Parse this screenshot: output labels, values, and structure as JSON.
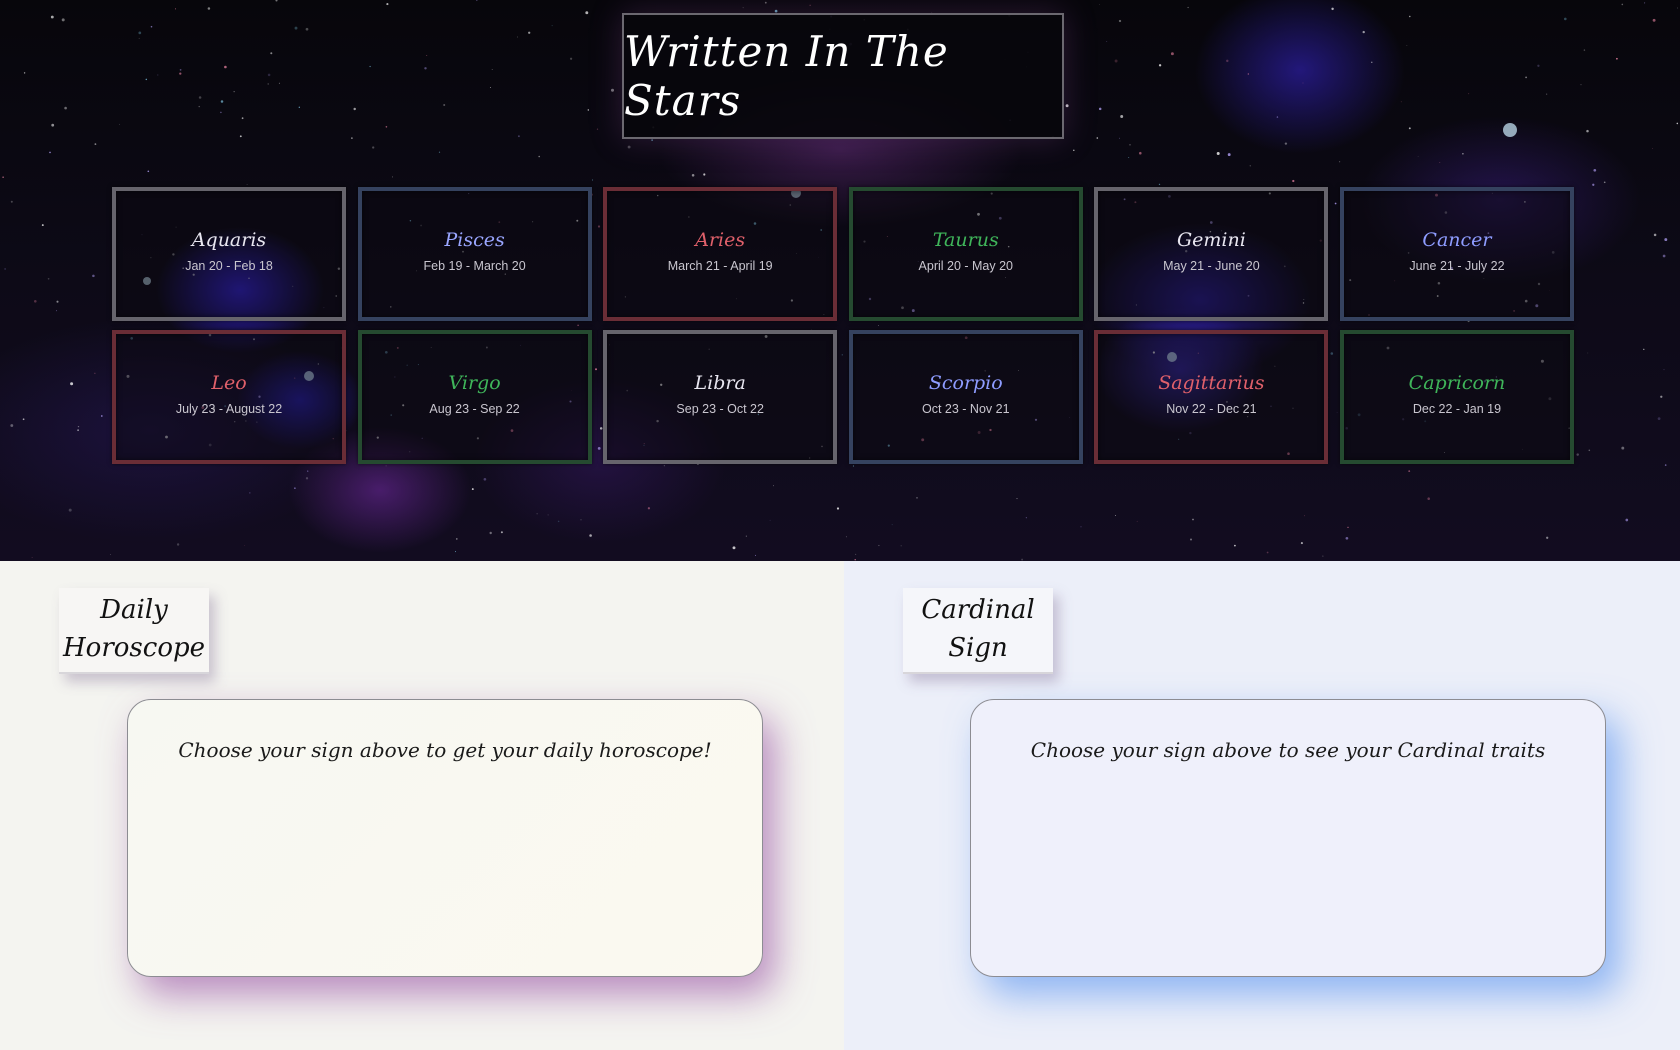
{
  "header": {
    "title": "Written In The Stars"
  },
  "signs": [
    {
      "name": "Aquaris",
      "dates": "Jan 20 - Feb 18",
      "name_color": "#e8e6f0",
      "border_color": "#66646c"
    },
    {
      "name": "Pisces",
      "dates": "Feb 19 - March 20",
      "name_color": "#9aa6ff",
      "border_color": "#35425f"
    },
    {
      "name": "Aries",
      "dates": "March 21 - April 19",
      "name_color": "#e0606a",
      "border_color": "#6a2d36"
    },
    {
      "name": "Taurus",
      "dates": "April 20 - May 20",
      "name_color": "#3fb55a",
      "border_color": "#254a30"
    },
    {
      "name": "Gemini",
      "dates": "May 21 - June 20",
      "name_color": "#e8e6f0",
      "border_color": "#66646c"
    },
    {
      "name": "Cancer",
      "dates": "June 21 - July 22",
      "name_color": "#8e9cff",
      "border_color": "#35425f"
    },
    {
      "name": "Leo",
      "dates": "July 23 - August 22",
      "name_color": "#e0606a",
      "border_color": "#6a2d36"
    },
    {
      "name": "Virgo",
      "dates": "Aug 23 - Sep 22",
      "name_color": "#3fb55a",
      "border_color": "#254a30"
    },
    {
      "name": "Libra",
      "dates": "Sep 23 - Oct 22",
      "name_color": "#e8e6f0",
      "border_color": "#66646c"
    },
    {
      "name": "Scorpio",
      "dates": "Oct 23 - Nov 21",
      "name_color": "#8e9cff",
      "border_color": "#35425f"
    },
    {
      "name": "Sagittarius",
      "dates": "Nov 22 - Dec 21",
      "name_color": "#e0606a",
      "border_color": "#6a2d36"
    },
    {
      "name": "Capricorn",
      "dates": "Dec 22 - Jan 19",
      "name_color": "#3fb55a",
      "border_color": "#254a30"
    }
  ],
  "daily_horoscope": {
    "heading_line1": "Daily",
    "heading_line2": "Horoscope",
    "message": "Choose your sign above to get your daily horoscope!"
  },
  "cardinal_sign": {
    "heading_line1": "Cardinal",
    "heading_line2": "Sign",
    "message": "Choose your sign above to see your Cardinal traits"
  }
}
